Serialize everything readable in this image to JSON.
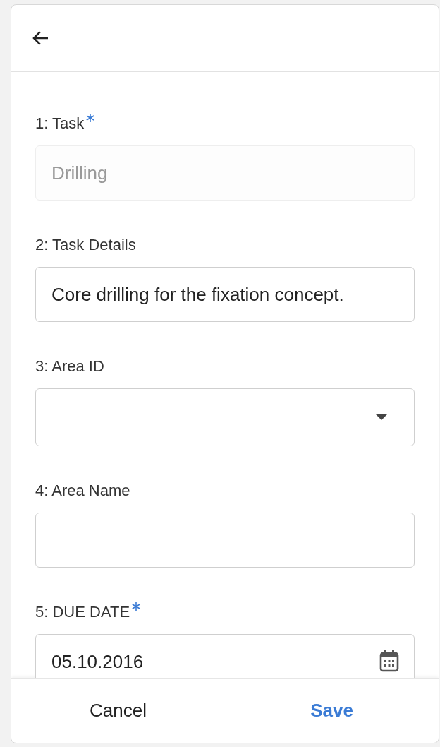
{
  "header": {
    "back": true
  },
  "fields": [
    {
      "kind": "text",
      "label": "1: Task",
      "required": true,
      "value": "Drilling",
      "disabled": true
    },
    {
      "kind": "text",
      "label": "2: Task Details",
      "required": false,
      "value": "Core drilling for the fixation concept.",
      "disabled": false
    },
    {
      "kind": "dropdown",
      "label": "3: Area ID",
      "required": false,
      "disabled": false
    },
    {
      "kind": "text",
      "label": "4: Area Name",
      "required": false,
      "disabled": false
    },
    {
      "kind": "date",
      "label": "5: DUE DATE",
      "required": true,
      "value": "05.10.2016",
      "disabled": false
    }
  ],
  "footer": {
    "cancel": "Cancel",
    "save": "Save"
  }
}
